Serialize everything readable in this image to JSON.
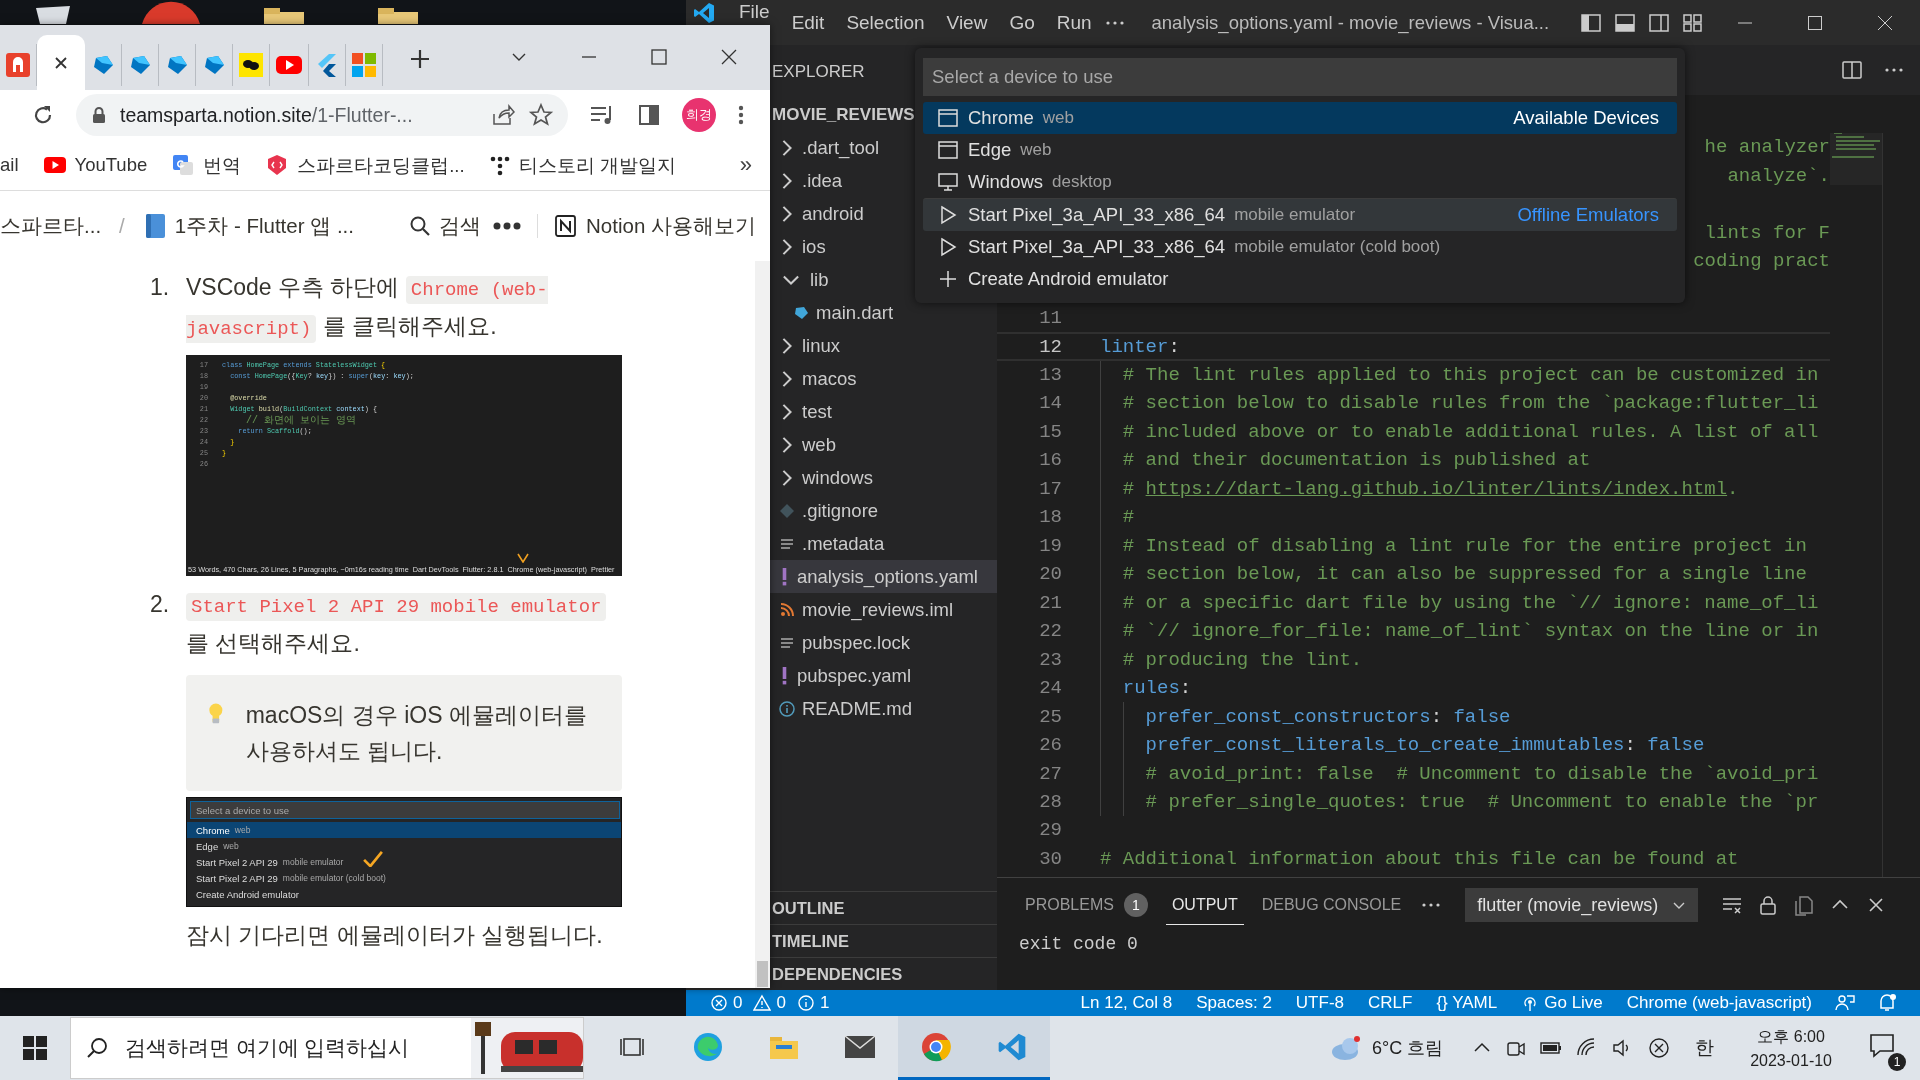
{
  "browser": {
    "tabs": [
      {
        "kind": "helmet",
        "selected": false
      },
      {
        "kind": "blank",
        "selected": true
      },
      {
        "kind": "diamond",
        "selected": false
      },
      {
        "kind": "diamond",
        "selected": false
      },
      {
        "kind": "diamond",
        "selected": false
      },
      {
        "kind": "diamond",
        "selected": false
      },
      {
        "kind": "chat",
        "selected": false
      },
      {
        "kind": "play",
        "selected": false
      },
      {
        "kind": "chevron",
        "selected": false
      },
      {
        "kind": "squares",
        "selected": false
      }
    ],
    "address": {
      "host": "teamsparta.notion.site",
      "path": "/1-Flutter-..."
    },
    "profile": "희경",
    "bookmarks": [
      {
        "kind": "none",
        "label": "ail"
      },
      {
        "kind": "play",
        "label": "YouTube"
      },
      {
        "kind": "translate",
        "label": "번역"
      },
      {
        "kind": "code",
        "label": "스파르타코딩클럽..."
      },
      {
        "kind": "dots",
        "label": "티스토리 개발일지"
      }
    ],
    "bookmarks_more": "»"
  },
  "notion": {
    "breadcrumbs": [
      {
        "kind": "plain",
        "label": "스파르타..."
      },
      {
        "kind": "book",
        "label": "1주차 - Flutter 앱 ..."
      }
    ],
    "breadcrumb_separator": "/",
    "search": "검색",
    "cta": "Notion 사용해보기",
    "blocks": [
      {
        "kind": "list_item",
        "number": "1.",
        "parts": [
          {
            "kind": "text",
            "text": "VSCode 우측 하단에 "
          },
          {
            "kind": "code",
            "text": "Chrome (web-javascript)"
          },
          {
            "kind": "text",
            "text": " 를 클릭해주세요."
          }
        ]
      },
      {
        "kind": "code_screenshot",
        "lines": [
          {
            "number": "17",
            "segments": [
              {
                "kind": "kw",
                "text": "class "
              },
              {
                "kind": "type",
                "text": "HomePage "
              },
              {
                "kind": "kw",
                "text": "extends "
              },
              {
                "kind": "type",
                "text": "StatelessWidget "
              },
              {
                "kind": "brace",
                "text": "{"
              }
            ]
          },
          {
            "number": "18",
            "segments": [
              {
                "kind": "kw",
                "text": "  const "
              },
              {
                "kind": "type",
                "text": "HomePage"
              },
              {
                "kind": "punct",
                "text": "({"
              },
              {
                "kind": "type",
                "text": "Key"
              },
              {
                "kind": "punct",
                "text": "? "
              },
              {
                "kind": "param",
                "text": "key"
              },
              {
                "kind": "punct",
                "text": "}) : "
              },
              {
                "kind": "kw",
                "text": "super"
              },
              {
                "kind": "punct",
                "text": "("
              },
              {
                "kind": "param",
                "text": "key"
              },
              {
                "kind": "punct",
                "text": ": "
              },
              {
                "kind": "param",
                "text": "key"
              },
              {
                "kind": "punct",
                "text": ");"
              }
            ]
          },
          {
            "number": "19"
          },
          {
            "number": "20",
            "segments": [
              {
                "kind": "fn",
                "text": "  @override"
              }
            ]
          },
          {
            "number": "21",
            "segments": [
              {
                "kind": "type",
                "text": "  Widget "
              },
              {
                "kind": "fn",
                "text": "build"
              },
              {
                "kind": "punct",
                "text": "("
              },
              {
                "kind": "type",
                "text": "BuildContext "
              },
              {
                "kind": "param",
                "text": "context"
              },
              {
                "kind": "punct",
                "text": ") {"
              }
            ]
          },
          {
            "number": "22",
            "segments": [
              {
                "kind": "comment",
                "text": "    // 화면에 보이는 영역"
              }
            ]
          },
          {
            "number": "23",
            "segments": [
              {
                "kind": "kw",
                "text": "    return "
              },
              {
                "kind": "type",
                "text": "Scaffold"
              },
              {
                "kind": "punct",
                "text": "();"
              }
            ]
          },
          {
            "number": "24",
            "segments": [
              {
                "kind": "brace",
                "text": "  }"
              }
            ]
          },
          {
            "number": "25",
            "segments": [
              {
                "kind": "brace",
                "text": "}"
              }
            ]
          },
          {
            "number": "26"
          }
        ],
        "status": [
          "53 Words, 470 Chars, 26 Lines, 5 Paragraphs, ~0m16s reading time",
          "Dart DevTools",
          "Flutter: 2.8.1",
          "Chrome (web-javascript)",
          "Prettier"
        ]
      },
      {
        "kind": "list_item",
        "number": "2.",
        "parts": [
          {
            "kind": "code",
            "text": "Start Pixel 2 API 29 mobile emulator"
          },
          {
            "kind": "text",
            "text": " 를 선택해주세요."
          }
        ]
      },
      {
        "kind": "callout",
        "text": "macOS의 경우 iOS 에뮬레이터를 사용하셔도 됩니다."
      },
      {
        "kind": "picker_screenshot",
        "placeholder": "Select a device to use",
        "items": [
          {
            "label": "Chrome",
            "detail": "web",
            "selected": true,
            "marked": false
          },
          {
            "label": "Edge",
            "detail": "web",
            "selected": false,
            "marked": false
          },
          {
            "label": "Start Pixel 2 API 29",
            "detail": "mobile emulator",
            "selected": false,
            "marked": true
          },
          {
            "label": "Start Pixel 2 API 29",
            "detail": "mobile emulator (cold boot)",
            "selected": false,
            "marked": false
          },
          {
            "label": "Create Android emulator",
            "selected": false,
            "marked": false
          }
        ]
      },
      {
        "kind": "paragraph",
        "text": "잠시 기다리면 에뮬레이터가 실행됩니다."
      }
    ]
  },
  "vscode": {
    "menu": [
      "File",
      "Edit",
      "Selection",
      "View",
      "Go",
      "Run"
    ],
    "title": "analysis_options.yaml - movie_reviews - Visua...",
    "explorer": {
      "title": "EXPLORER",
      "project": "MOVIE_REVIEWS",
      "tree": [
        {
          "kind": "folder",
          "label": ".dart_tool",
          "expanded": false,
          "selected": false
        },
        {
          "kind": "folder",
          "label": ".idea",
          "expanded": false,
          "selected": false
        },
        {
          "kind": "folder",
          "label": "android",
          "expanded": false,
          "selected": false
        },
        {
          "kind": "folder",
          "label": "ios",
          "expanded": false,
          "selected": false
        },
        {
          "kind": "folder",
          "label": "lib",
          "expanded": true,
          "selected": false,
          "children": [
            {
              "kind": "dart",
              "label": "main.dart",
              "selected": false
            }
          ]
        },
        {
          "kind": "folder",
          "label": "linux",
          "expanded": false,
          "selected": false
        },
        {
          "kind": "folder",
          "label": "macos",
          "expanded": false,
          "selected": false
        },
        {
          "kind": "folder",
          "label": "test",
          "expanded": false,
          "selected": false
        },
        {
          "kind": "folder",
          "label": "web",
          "expanded": false,
          "selected": false
        },
        {
          "kind": "folder",
          "label": "windows",
          "expanded": false,
          "selected": false
        },
        {
          "kind": "ignore",
          "label": ".gitignore",
          "selected": false
        },
        {
          "kind": "lines",
          "label": ".metadata",
          "selected": false
        },
        {
          "kind": "yaml",
          "label": "analysis_options.yaml",
          "selected": true
        },
        {
          "kind": "feed",
          "label": "movie_reviews.iml",
          "selected": false
        },
        {
          "kind": "lines",
          "label": "pubspec.lock",
          "selected": false
        },
        {
          "kind": "yaml",
          "label": "pubspec.yaml",
          "selected": false
        },
        {
          "kind": "info",
          "label": "README.md",
          "selected": false
        }
      ],
      "sections": [
        "OUTLINE",
        "TIMELINE",
        "DEPENDENCIES"
      ]
    },
    "editor": {
      "lines": [
        {
          "current": false,
          "segments": [
            {
              "kind": "comment",
              "text": "he analyzer"
            }
          ]
        },
        {
          "current": false,
          "segments": [
            {
              "kind": "comment",
              "text": "analyze`."
            }
          ]
        },
        {
          "current": false
        },
        {
          "current": false,
          "segments": [
            {
              "kind": "comment",
              "text": "lints for F"
            }
          ]
        },
        {
          "current": false,
          "segments": [
            {
              "kind": "comment",
              "text": "coding pract"
            }
          ]
        },
        {
          "current": false
        },
        {
          "number": "11",
          "current": false
        },
        {
          "number": "12",
          "current": true,
          "segments": [
            {
              "kind": "key",
              "text": "linter"
            },
            {
              "kind": "punct",
              "text": ":"
            }
          ]
        },
        {
          "number": "13",
          "current": false,
          "segments": [
            {
              "kind": "comment",
              "text": "  # The lint rules applied to this project can be customized in"
            }
          ]
        },
        {
          "number": "14",
          "current": false,
          "segments": [
            {
              "kind": "comment",
              "text": "  # section below to disable rules from the `package:flutter_li"
            }
          ]
        },
        {
          "number": "15",
          "current": false,
          "segments": [
            {
              "kind": "comment",
              "text": "  # included above or to enable additional rules. A list of all"
            }
          ]
        },
        {
          "number": "16",
          "current": false,
          "segments": [
            {
              "kind": "comment",
              "text": "  # and their documentation is published at"
            }
          ]
        },
        {
          "number": "17",
          "current": false,
          "segments": [
            {
              "kind": "comment",
              "text": "  # "
            },
            {
              "kind": "link",
              "text": "https://dart-lang.github.io/linter/lints/index.html"
            },
            {
              "kind": "comment",
              "text": "."
            }
          ]
        },
        {
          "number": "18",
          "current": false,
          "segments": [
            {
              "kind": "comment",
              "text": "  #"
            }
          ]
        },
        {
          "number": "19",
          "current": false,
          "segments": [
            {
              "kind": "comment",
              "text": "  # Instead of disabling a lint rule for the entire project in"
            }
          ]
        },
        {
          "number": "20",
          "current": false,
          "segments": [
            {
              "kind": "comment",
              "text": "  # section below, it can also be suppressed for a single line"
            }
          ]
        },
        {
          "number": "21",
          "current": false,
          "segments": [
            {
              "kind": "comment",
              "text": "  # or a specific dart file by using the `// ignore: name_of_li"
            }
          ]
        },
        {
          "number": "22",
          "current": false,
          "segments": [
            {
              "kind": "comment",
              "text": "  # `// ignore_for_file: name_of_lint` syntax on the line or in"
            }
          ]
        },
        {
          "number": "23",
          "current": false,
          "segments": [
            {
              "kind": "comment",
              "text": "  # producing the lint."
            }
          ]
        },
        {
          "number": "24",
          "current": false,
          "segments": [
            {
              "kind": "key",
              "text": "  rules"
            },
            {
              "kind": "punct",
              "text": ":"
            }
          ]
        },
        {
          "number": "25",
          "current": false,
          "segments": [
            {
              "kind": "key",
              "text": "    prefer_const_constructors"
            },
            {
              "kind": "punct",
              "text": ": "
            },
            {
              "kind": "bool",
              "text": "false"
            }
          ]
        },
        {
          "number": "26",
          "current": false,
          "segments": [
            {
              "kind": "key",
              "text": "    prefer_const_literals_to_create_immutables"
            },
            {
              "kind": "punct",
              "text": ": "
            },
            {
              "kind": "bool",
              "text": "false"
            }
          ]
        },
        {
          "number": "27",
          "current": false,
          "segments": [
            {
              "kind": "comment",
              "text": "    # avoid_print: false  # Uncomment to disable the `avoid_pri"
            }
          ]
        },
        {
          "number": "28",
          "current": false,
          "segments": [
            {
              "kind": "comment",
              "text": "    # prefer_single_quotes: true  # Uncomment to enable the `pr"
            }
          ]
        },
        {
          "number": "29",
          "current": false
        },
        {
          "number": "30",
          "current": false,
          "segments": [
            {
              "kind": "comment",
              "text": "# Additional information about this file can be found at"
            }
          ]
        }
      ]
    },
    "quick_pick": {
      "placeholder": "Select a device to use",
      "items": [
        {
          "kind": "browser",
          "label": "Chrome",
          "detail": "web",
          "group": "Available Devices",
          "selected": true,
          "hovered": false
        },
        {
          "kind": "browser",
          "label": "Edge",
          "detail": "web",
          "selected": false,
          "hovered": false
        },
        {
          "kind": "desktop",
          "label": "Windows",
          "detail": "desktop",
          "selected": false,
          "hovered": false
        },
        {
          "kind": "emulator",
          "label": "Start Pixel_3a_API_33_x86_64",
          "detail": "mobile emulator",
          "group": "Offline Emulators",
          "selected": false,
          "hovered": true
        },
        {
          "kind": "emulator",
          "label": "Start Pixel_3a_API_33_x86_64",
          "detail": "mobile emulator (cold boot)",
          "selected": false,
          "hovered": false
        },
        {
          "kind": "create",
          "label": "Create Android emulator",
          "selected": false,
          "hovered": false
        }
      ]
    },
    "panel": {
      "tabs": [
        {
          "label": "PROBLEMS",
          "badge": "1",
          "selected": false
        },
        {
          "label": "OUTPUT",
          "selected": true
        },
        {
          "label": "DEBUG CONSOLE",
          "selected": false
        }
      ],
      "channel": "flutter (movie_reviews)",
      "output": "exit code 0"
    },
    "status_bar": {
      "problems": [
        {
          "kind": "error",
          "count": "0"
        },
        {
          "kind": "warning",
          "count": "0"
        },
        {
          "kind": "info",
          "count": "1"
        }
      ],
      "items": [
        {
          "kind": "text",
          "label": "Ln 12, Col 8"
        },
        {
          "kind": "text",
          "label": "Spaces: 2"
        },
        {
          "kind": "text",
          "label": "UTF-8"
        },
        {
          "kind": "text",
          "label": "CRLF"
        },
        {
          "kind": "text",
          "label": "{} YAML"
        },
        {
          "kind": "live",
          "label": "Go Live"
        },
        {
          "kind": "text",
          "label": "Chrome (web-javascript)"
        }
      ]
    }
  },
  "taskbar": {
    "search_placeholder": "검색하려면 여기에 입력하십시",
    "apps": [
      {
        "kind": "taskview",
        "active": false
      },
      {
        "kind": "swirl",
        "active": false
      },
      {
        "kind": "folder",
        "active": false
      },
      {
        "kind": "mail",
        "active": false
      },
      {
        "kind": "circle",
        "active": true
      },
      {
        "kind": "ribbon",
        "active": true
      }
    ],
    "weather": "6°C 흐림",
    "ime": "한",
    "time": "오후 6:00",
    "date": "2023-01-10",
    "notifications": "1"
  }
}
